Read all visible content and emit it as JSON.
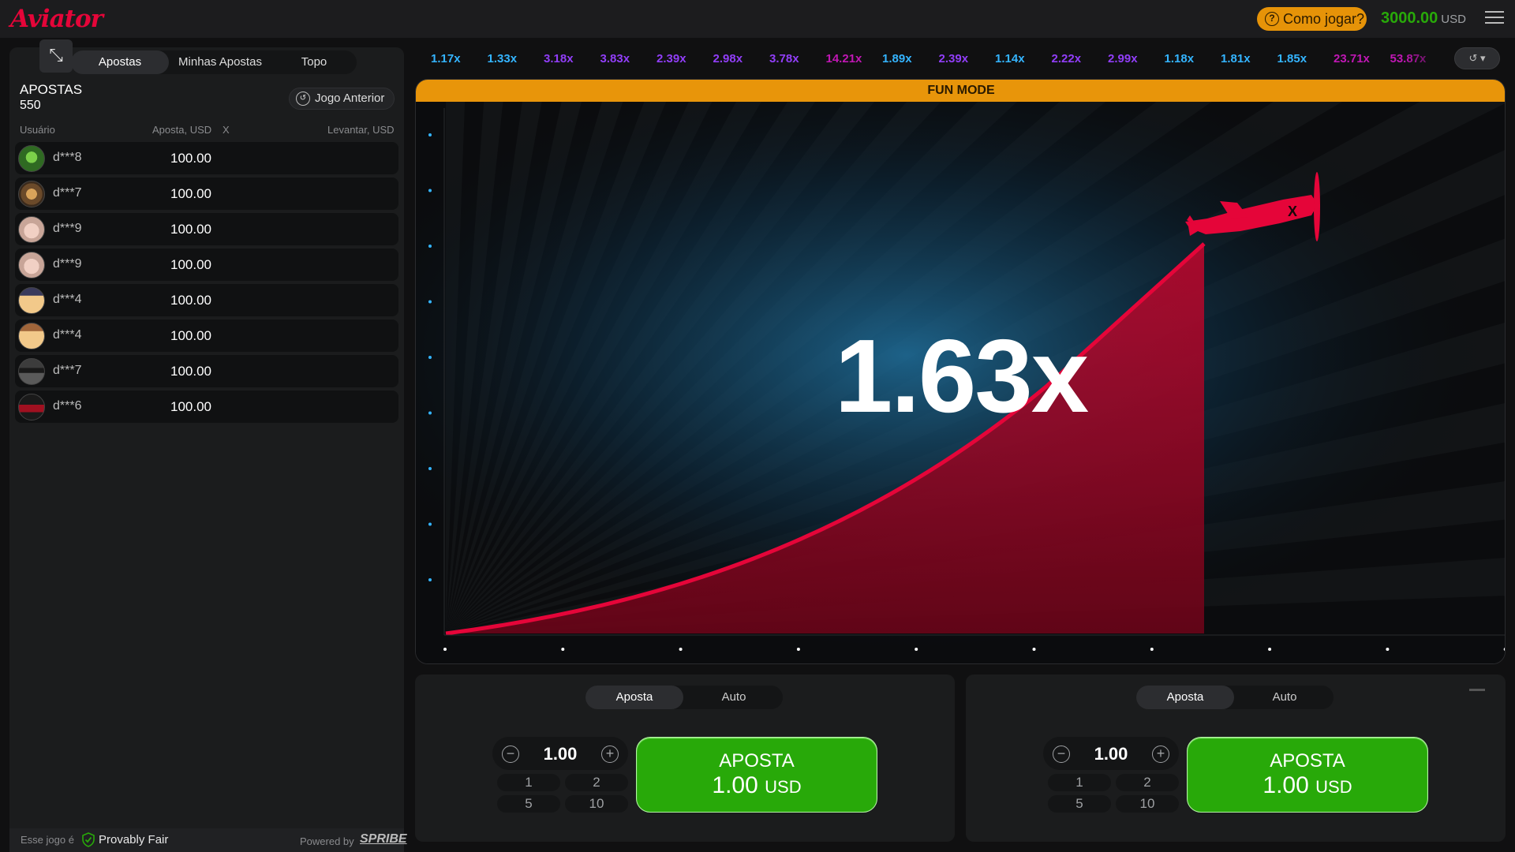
{
  "header": {
    "logo": "Aviator",
    "how_to_play": "Como jogar?",
    "balance": "3000.00",
    "currency": "USD"
  },
  "left_panel": {
    "tabs": [
      "Apostas",
      "Minhas Apostas",
      "Topo"
    ],
    "active_tab": "Apostas",
    "title": "APOSTAS",
    "count": "550",
    "previous_button": "Jogo Anterior",
    "columns": {
      "user": "Usuário",
      "bet": "Aposta, USD",
      "x": "X",
      "cashout": "Levantar, USD"
    },
    "rows": [
      {
        "user": "d***8",
        "bet": "100.00",
        "avatar": "clover"
      },
      {
        "user": "d***7",
        "bet": "100.00",
        "avatar": "tiger"
      },
      {
        "user": "d***9",
        "bet": "100.00",
        "avatar": "pig"
      },
      {
        "user": "d***9",
        "bet": "100.00",
        "avatar": "pig"
      },
      {
        "user": "d***4",
        "bet": "100.00",
        "avatar": "monkey-hat"
      },
      {
        "user": "d***4",
        "bet": "100.00",
        "avatar": "monkey-hat"
      },
      {
        "user": "d***7",
        "bet": "100.00",
        "avatar": "sunglasses"
      },
      {
        "user": "d***6",
        "bet": "100.00",
        "avatar": "car"
      }
    ],
    "footer": {
      "prefix": "Esse jogo é",
      "fair": "Provably Fair",
      "powered": "Powered by",
      "brand": "SPRIBE"
    }
  },
  "history": [
    {
      "value": "1.17x",
      "color": "#34b4ff"
    },
    {
      "value": "1.33x",
      "color": "#34b4ff"
    },
    {
      "value": "3.18x",
      "color": "#913ef8"
    },
    {
      "value": "3.83x",
      "color": "#913ef8"
    },
    {
      "value": "2.39x",
      "color": "#913ef8"
    },
    {
      "value": "2.98x",
      "color": "#913ef8"
    },
    {
      "value": "3.78x",
      "color": "#913ef8"
    },
    {
      "value": "14.21x",
      "color": "#c017b4"
    },
    {
      "value": "1.89x",
      "color": "#34b4ff"
    },
    {
      "value": "2.39x",
      "color": "#913ef8"
    },
    {
      "value": "1.14x",
      "color": "#34b4ff"
    },
    {
      "value": "2.22x",
      "color": "#913ef8"
    },
    {
      "value": "2.99x",
      "color": "#913ef8"
    },
    {
      "value": "1.18x",
      "color": "#34b4ff"
    },
    {
      "value": "1.81x",
      "color": "#34b4ff"
    },
    {
      "value": "1.85x",
      "color": "#34b4ff"
    },
    {
      "value": "23.71x",
      "color": "#c017b4"
    },
    {
      "value": "53.87x",
      "color": "#c017b4"
    }
  ],
  "game": {
    "mode_banner": "FUN MODE",
    "multiplier": "1.63x",
    "curve_color": "#e50539"
  },
  "bet_panels": [
    {
      "tabs": [
        "Aposta",
        "Auto"
      ],
      "active": "Aposta",
      "amount": "1.00",
      "quick": [
        "1",
        "2",
        "5",
        "10"
      ],
      "button_label": "APOSTA",
      "button_amount": "1.00",
      "button_currency": "USD"
    },
    {
      "tabs": [
        "Aposta",
        "Auto"
      ],
      "active": "Aposta",
      "amount": "1.00",
      "quick": [
        "1",
        "2",
        "5",
        "10"
      ],
      "button_label": "APOSTA",
      "button_amount": "1.00",
      "button_currency": "USD"
    }
  ]
}
